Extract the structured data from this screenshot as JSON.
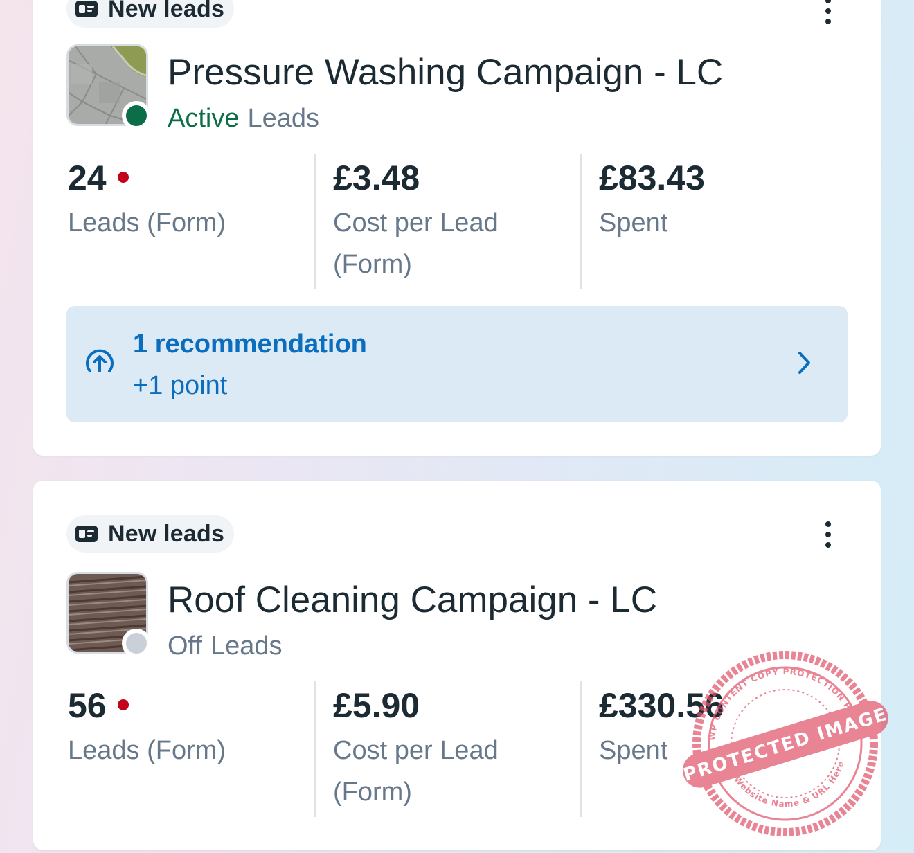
{
  "colors": {
    "accent_blue": "#0a6dbd",
    "recommendation_bg": "#dceaf6",
    "active_green": "#0b6e48",
    "off_grey": "#c9d0d8",
    "new_lead_dot": "#c3031b",
    "text_primary": "#1c2b33",
    "text_secondary": "#67788a",
    "watermark_red": "#e0556b"
  },
  "campaigns": [
    {
      "chip_label": "New leads",
      "chip_icon": "id-card-icon",
      "title": "Pressure Washing Campaign - LC",
      "thumbnail": "pressure-washed-paving-thumbnail",
      "status": "Active",
      "status_color": "#0b6e48",
      "objective": "Leads",
      "metrics": [
        {
          "value": "24",
          "label": "Leads (Form)",
          "new_indicator": true
        },
        {
          "value": "£3.48",
          "label": "Cost per Lead (Form)",
          "new_indicator": false
        },
        {
          "value": "£83.43",
          "label": "Spent",
          "new_indicator": false
        }
      ],
      "recommendation": {
        "icon": "arrow-up-circle-icon",
        "title": "1 recommendation",
        "subtitle": "+1 point"
      }
    },
    {
      "chip_label": "New leads",
      "chip_icon": "id-card-icon",
      "title": "Roof Cleaning Campaign - LC",
      "thumbnail": "roof-tiles-thumbnail",
      "status": "Off",
      "status_color": "#67788a",
      "objective": "Leads",
      "metrics": [
        {
          "value": "56",
          "label": "Leads (Form)",
          "new_indicator": true
        },
        {
          "value": "£5.90",
          "label": "Cost per Lead (Form)",
          "new_indicator": false
        },
        {
          "value": "£330.56",
          "label": "Spent",
          "new_indicator": false
        }
      ]
    }
  ],
  "watermark": {
    "ring_top": "WP CONTENT COPY PROTECTION PLUGIN",
    "band": "PROTECTED IMAGE",
    "ring_bottom": "My Website Name & URL Here"
  }
}
